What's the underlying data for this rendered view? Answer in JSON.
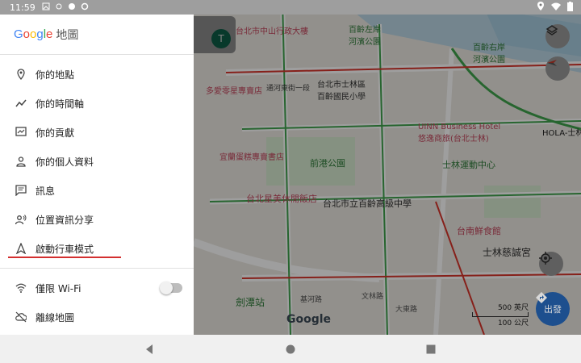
{
  "status_bar": {
    "time": "11:59"
  },
  "drawer": {
    "brand": {
      "letters": [
        "G",
        "o",
        "o",
        "g",
        "l",
        "e"
      ],
      "colors": [
        "#4285F4",
        "#EA4335",
        "#FBBC05",
        "#4285F4",
        "#34A853",
        "#EA4335"
      ],
      "title": "地圖"
    },
    "items": [
      {
        "icon": "location-pin-icon",
        "label": "你的地點"
      },
      {
        "icon": "timeline-icon",
        "label": "你的時間軸"
      },
      {
        "icon": "contributions-icon",
        "label": "你的貢獻"
      },
      {
        "icon": "person-icon",
        "label": "你的個人資料"
      },
      {
        "icon": "message-icon",
        "label": "訊息"
      },
      {
        "icon": "location-sharing-icon",
        "label": "位置資訊分享"
      },
      {
        "icon": "navigation-arrow-icon",
        "label": "啟動行車模式"
      }
    ],
    "items2": [
      {
        "icon": "wifi-icon",
        "label": "僅限 Wi-Fi"
      },
      {
        "icon": "offline-map-icon",
        "label": "離線地圖"
      }
    ],
    "highlight_color": "#d32f2f"
  },
  "map": {
    "avatar_letter": "T",
    "labels": [
      "台北市中山行政大樓",
      "百齡右岸\n河濱公園",
      "百齡左岸\n河濱公園",
      "多愛零星專賣店",
      "通河東街一段",
      "台北市士林區\n百齡國民小學",
      "UINN Business Hotel\n悠逸商旅(台北士林)",
      "HOLA-士林",
      "宜蘭蛋糕專賣書店",
      "前港公園",
      "士林運動中心",
      "台北星美休閒飯店",
      "台北市立百齡高級中學",
      "台南鮮食館",
      "士林慈誠宮",
      "劍潭站",
      "基河路",
      "大東路",
      "文林路"
    ],
    "scale": {
      "ft": "500 英尺",
      "m": "100 公尺"
    },
    "go_label": "出發",
    "google_logo": "Google"
  }
}
